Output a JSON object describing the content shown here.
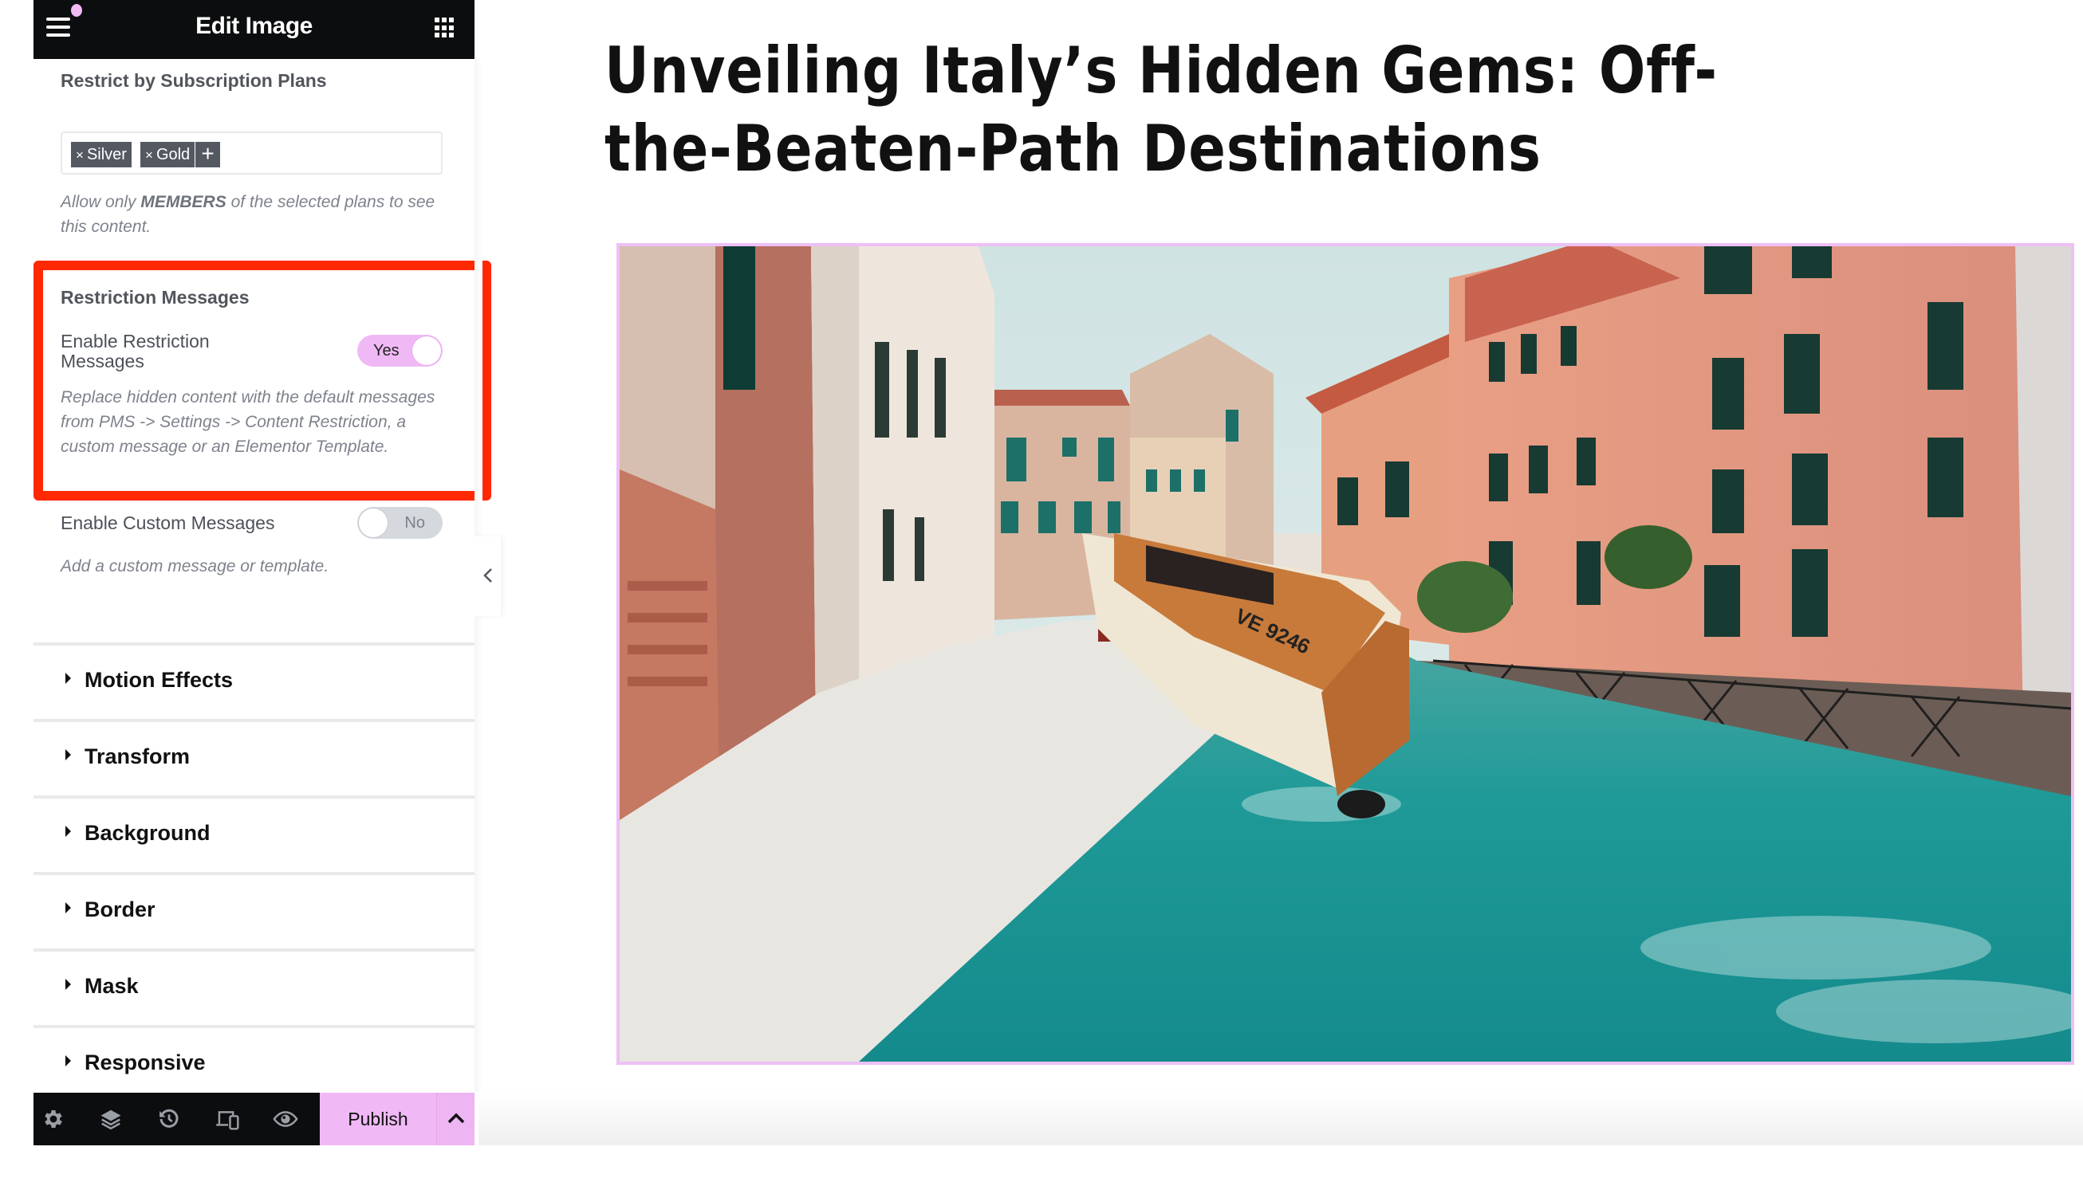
{
  "panel": {
    "header": {
      "title": "Edit Image",
      "menu_icon": "hamburger-menu-icon",
      "widgets_icon": "grid-apps-icon",
      "notification_color": "#f0b9f5"
    },
    "restrict_plans": {
      "heading": "Restrict by Subscription Plans",
      "tags": [
        {
          "label": "Silver",
          "remove": "×"
        },
        {
          "label": "Gold",
          "remove": "×"
        }
      ],
      "add_label": "+",
      "help_prefix": "Allow only ",
      "help_bold": "MEMBERS",
      "help_suffix": " of the selected plans to see this content."
    },
    "restriction_messages": {
      "heading": "Restriction Messages",
      "enable_label": "Enable Restriction Messages",
      "enable_value": "Yes",
      "enable_on": true,
      "help": "Replace hidden content with the default messages from PMS -> Settings -> Content Restriction, a custom message or an Elementor Template.",
      "highlight_color": "#ff2800"
    },
    "custom_messages": {
      "enable_label": "Enable Custom Messages",
      "enable_value": "No",
      "enable_on": false,
      "help": "Add a custom message or template."
    },
    "sections": [
      {
        "label": "Motion Effects"
      },
      {
        "label": "Transform"
      },
      {
        "label": "Background"
      },
      {
        "label": "Border"
      },
      {
        "label": "Mask"
      },
      {
        "label": "Responsive"
      }
    ],
    "footer": {
      "icons": [
        "settings-gear-icon",
        "layers-navigator-icon",
        "history-icon",
        "responsive-mode-icon",
        "preview-eye-icon"
      ],
      "publish_label": "Publish",
      "accent_color": "#f0b9f5"
    }
  },
  "canvas": {
    "post_title": "Unveiling Italy’s Hidden Gems: Off-the-Beaten-Path Destinations",
    "featured_image": {
      "alt": "Venice canal with colorful buildings and a wooden water taxi (VE 9246)",
      "boat_registration": "VE 9246",
      "selection_border_color": "#eec0f5"
    }
  }
}
